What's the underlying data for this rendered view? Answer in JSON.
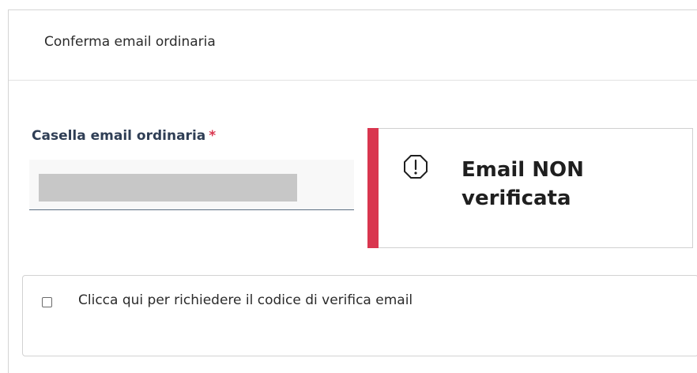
{
  "panel": {
    "title": "Conferma email ordinaria"
  },
  "email_field": {
    "label": "Casella email ordinaria",
    "required_marker": "*",
    "value": ""
  },
  "alert": {
    "icon": "exclamation-circle-icon",
    "message": "Email NON verificata",
    "accent_color": "#d9364f"
  },
  "request_code": {
    "label": "Clicca qui per richiedere il codice di verifica email",
    "checked": false
  }
}
